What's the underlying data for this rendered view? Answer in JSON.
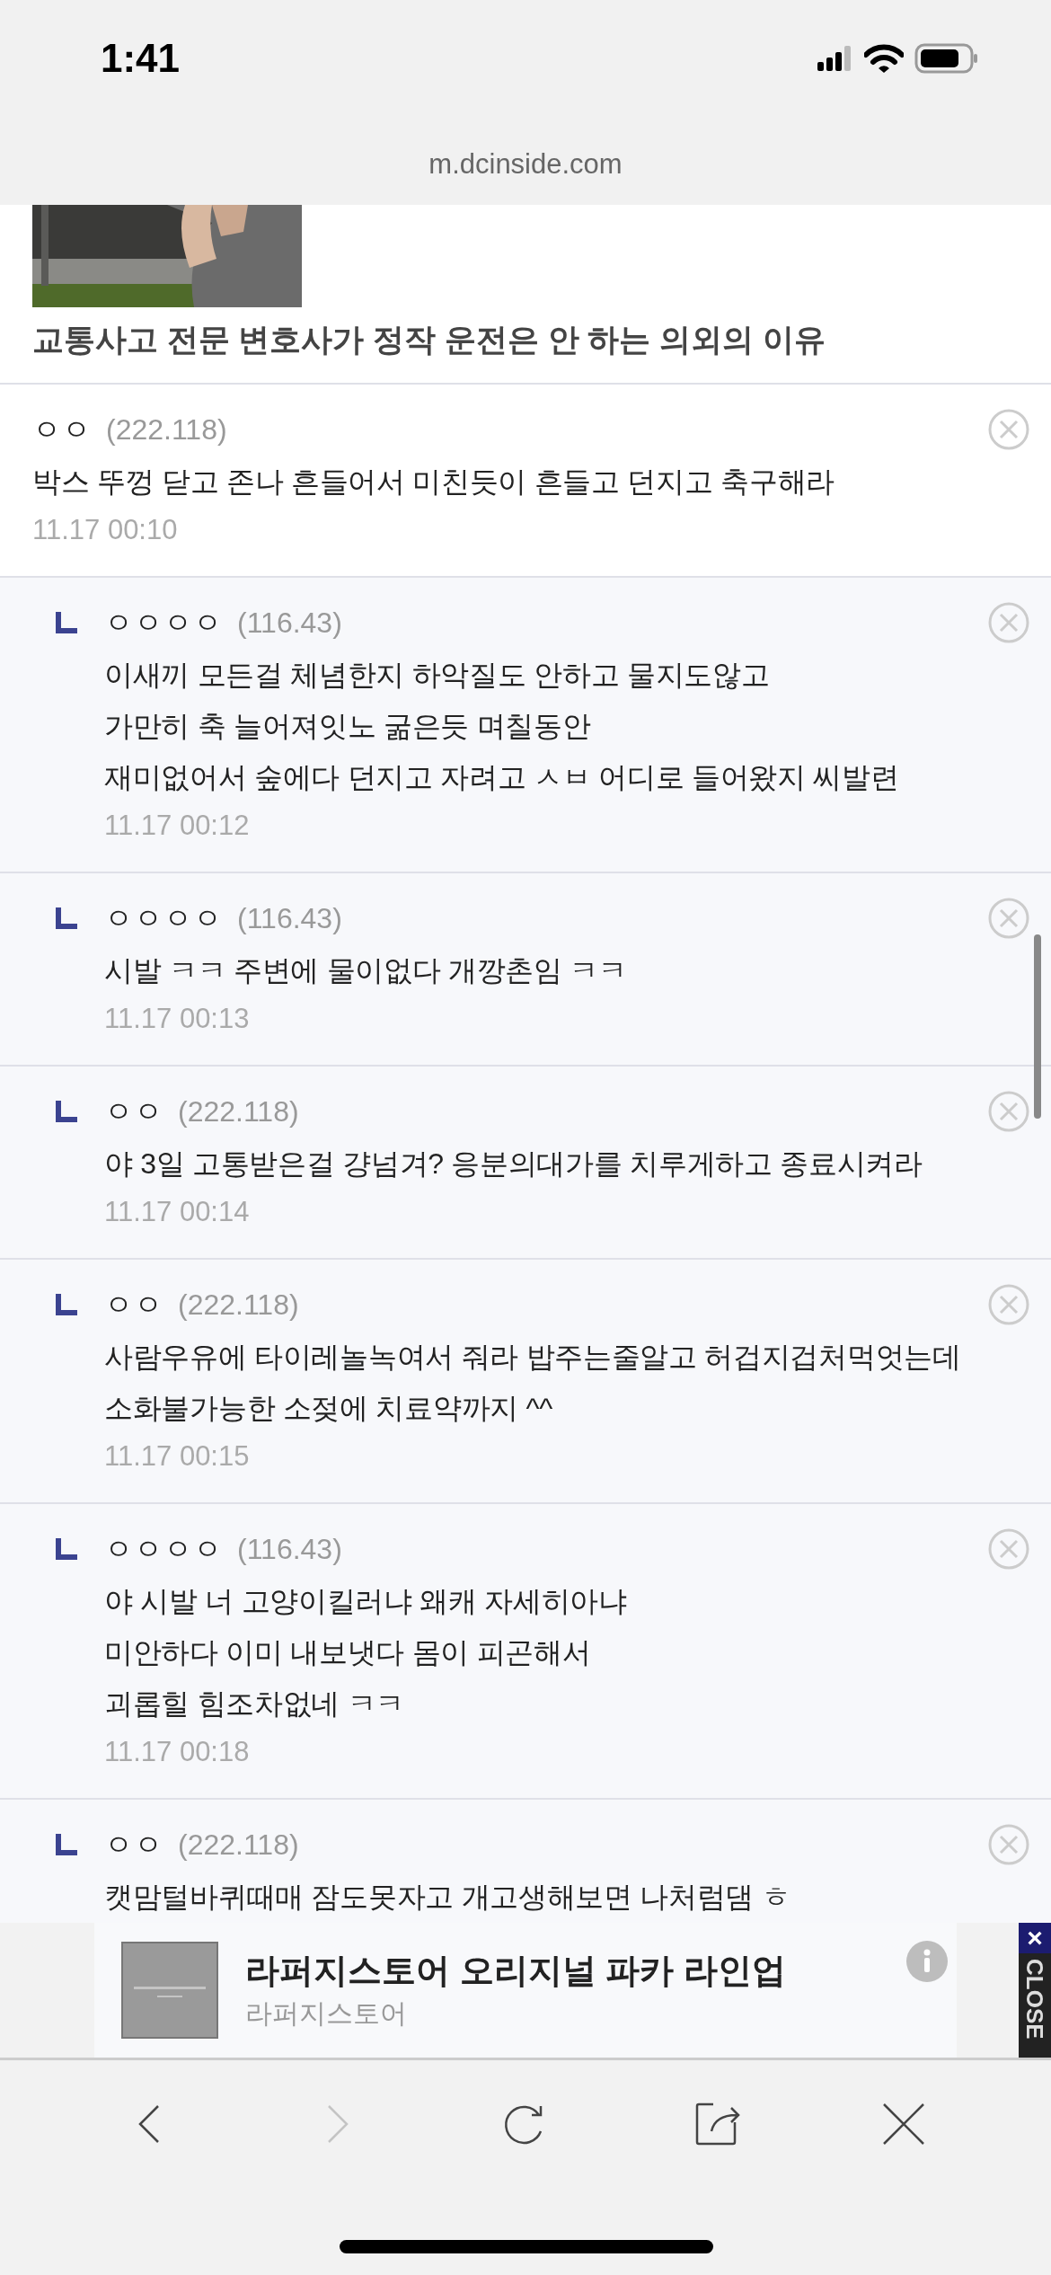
{
  "status_bar": {
    "time": "1:41"
  },
  "browser": {
    "url": "m.dcinside.com"
  },
  "article": {
    "title": "교통사고 전문 변호사가 정작 운전은 안 하는 의외의 이유"
  },
  "comments": [
    {
      "kind": "comment",
      "nickname": "ㅇㅇ",
      "ip": "(222.118)",
      "text": "박스 뚜껑 닫고 존나 흔들어서 미친듯이 흔들고 던지고 축구해라",
      "date": "11.17 00:10"
    },
    {
      "kind": "reply",
      "nickname": "ㅇㅇㅇㅇ",
      "ip": "(116.43)",
      "text": "이새끼 모든걸 체념한지 하악질도 안하고 물지도않고\n가만히 축 늘어져잇노 굶은듯 며칠동안\n재미없어서 숲에다 던지고 자려고 ㅅㅂ 어디로 들어왔지 씨발련",
      "date": "11.17 00:12"
    },
    {
      "kind": "reply",
      "nickname": "ㅇㅇㅇㅇ",
      "ip": "(116.43)",
      "text": "시발 ㅋㅋ 주변에 물이없다 개깡촌임 ㅋㅋ",
      "date": "11.17 00:13"
    },
    {
      "kind": "reply",
      "nickname": "ㅇㅇ",
      "ip": "(222.118)",
      "text": "야 3일 고통받은걸 걍넘겨? 응분의대가를 치루게하고 종료시켜라",
      "date": "11.17 00:14"
    },
    {
      "kind": "reply",
      "nickname": "ㅇㅇ",
      "ip": "(222.118)",
      "text": "사람우유에 타이레놀녹여서 줘라 밥주는줄알고 허겁지겁처먹엇는데\n소화불가능한 소젖에 치료약까지 ^^",
      "date": "11.17 00:15"
    },
    {
      "kind": "reply",
      "nickname": "ㅇㅇㅇㅇ",
      "ip": "(116.43)",
      "text": "야 시발 너 고양이킬러냐 왜캐 자세히아냐\n미안하다 이미 내보냇다 몸이 피곤해서\n괴롭힐 힘조차없네 ㅋㅋ",
      "date": "11.17 00:18"
    },
    {
      "kind": "reply",
      "nickname": "ㅇㅇ",
      "ip": "(222.118)",
      "text": "캣맘털바퀴때매 잠도못자고 개고생해보면 나처럼댐 ㅎ"
    }
  ],
  "ad": {
    "title": "라퍼지스토어 오리지널 파카 라인업",
    "advertiser": "라퍼지스토어",
    "close_label": "CLOSE",
    "close_mark": "×"
  },
  "toolbar": [
    {
      "kind": "back",
      "disabled": false
    },
    {
      "kind": "forward",
      "disabled": true
    },
    {
      "kind": "reload",
      "disabled": false
    },
    {
      "kind": "share",
      "disabled": false
    },
    {
      "kind": "close",
      "disabled": false
    }
  ]
}
